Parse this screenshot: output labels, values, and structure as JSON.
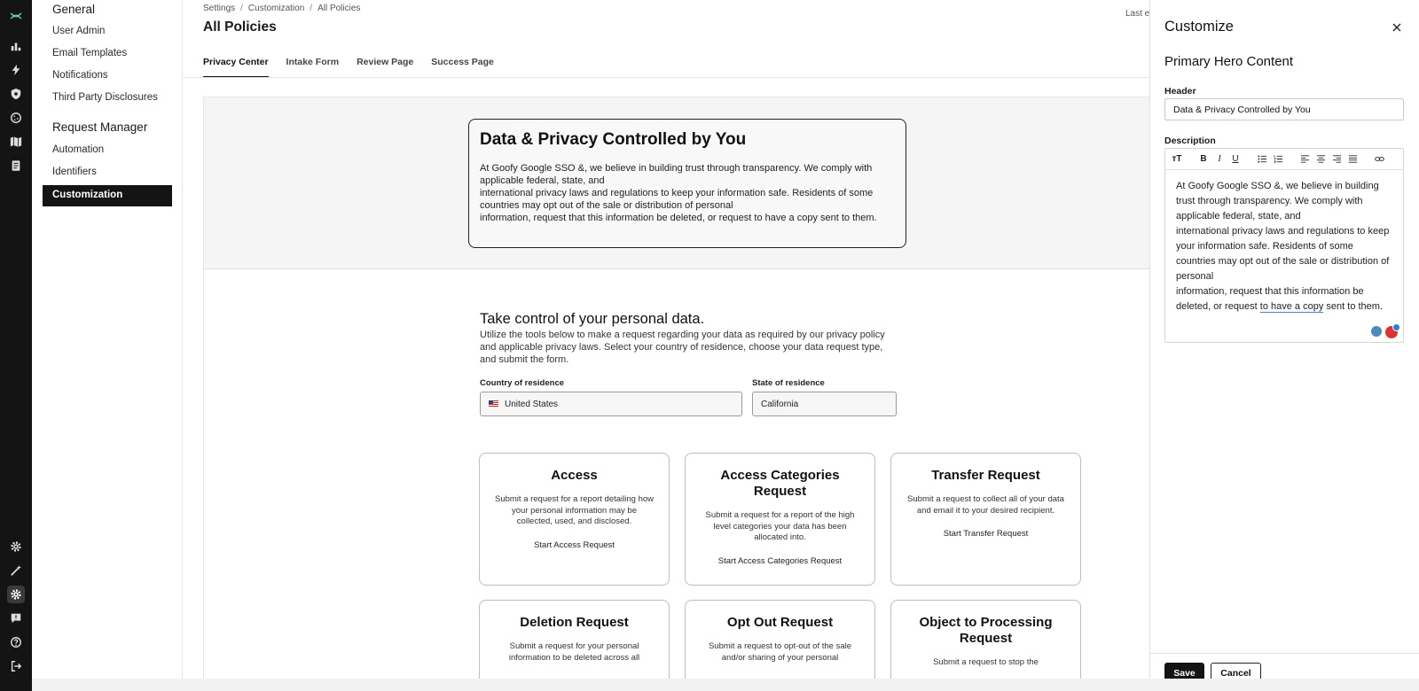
{
  "sidebar": {
    "groups": [
      {
        "label": "General"
      },
      {
        "label": "Request Manager"
      }
    ],
    "items": [
      {
        "label": "User Admin"
      },
      {
        "label": "Email Templates"
      },
      {
        "label": "Notifications"
      },
      {
        "label": "Third Party Disclosures"
      },
      {
        "label": "Automation"
      },
      {
        "label": "Identifiers"
      },
      {
        "label": "Customization"
      }
    ]
  },
  "rail": {
    "icons": [
      "logo-icon",
      "chart-icon",
      "bolt-icon",
      "shield-icon",
      "cookie-icon",
      "map-icon",
      "document-icon",
      "gear-icon",
      "wand-icon",
      "settings-icon",
      "feedback-icon",
      "help-icon",
      "logout-icon"
    ]
  },
  "main": {
    "breadcrumb": [
      "Settings",
      "Customization",
      "All Policies"
    ],
    "last_edit": "Last e",
    "title": "All Policies",
    "tabs": [
      {
        "label": "Privacy Center"
      },
      {
        "label": "Intake Form"
      },
      {
        "label": "Review Page"
      },
      {
        "label": "Success Page"
      }
    ],
    "hero": {
      "title": "Data & Privacy Controlled by You",
      "description": "At Goofy Google SSO &, we believe in building trust through transparency. We comply with applicable federal, state, and\n international privacy laws and regulations to keep your information safe. Residents of some countries may opt out of the sale or distribution of personal\n information, request that this information be deleted, or request to have a copy sent to them."
    },
    "take_control": {
      "title": "Take control of your personal data.",
      "description": "Utilize the tools below to make a request regarding your data as required by our privacy policy and applicable privacy laws. Select your country of residence, choose your data request type, and submit the form."
    },
    "country": {
      "label": "Country of residence",
      "value": "United States"
    },
    "state": {
      "label": "State of residence",
      "value": "California"
    },
    "cards": [
      {
        "title": "Access",
        "desc": "Submit a request for a report detailing how your personal information may be collected, used, and disclosed.",
        "link": "Start Access Request"
      },
      {
        "title": "Access Categories Request",
        "desc": "Submit a request for a report of the high level categories your data has been allocated into.",
        "link": "Start Access Categories Request"
      },
      {
        "title": "Transfer Request",
        "desc": "Submit a request to collect all of your data and email it to your desired recipient.",
        "link": "Start Transfer Request"
      },
      {
        "title": "Deletion Request",
        "desc": "Submit a request for your personal information to be deleted across all"
      },
      {
        "title": "Opt Out Request",
        "desc": "Submit a request to opt-out of the sale and/or sharing of your personal"
      },
      {
        "title": "Object to Processing Request",
        "desc": "Submit a request to stop the"
      }
    ]
  },
  "panel": {
    "title": "Customize",
    "subtitle": "Primary Hero Content",
    "header_label": "Header",
    "header_value": "Data & Privacy Controlled by You",
    "description_label": "Description",
    "editor_text_before": "At Goofy Google SSO &, we believe in building trust through transparency. We comply with applicable federal, state, and\n  international privacy laws and regulations to keep your information safe. Residents of some countries may opt out of the sale or distribution of personal\n  information, request that this information be deleted, or request ",
    "editor_text_underlined": "to have a copy",
    "editor_text_after": " sent to them.",
    "save_label": "Save",
    "cancel_label": "Cancel"
  },
  "colors": {
    "rail_bg": "#141414",
    "active_item_bg": "#141414",
    "hero_bg": "#f4f5f4",
    "link_underline": "#4a7fd1"
  }
}
